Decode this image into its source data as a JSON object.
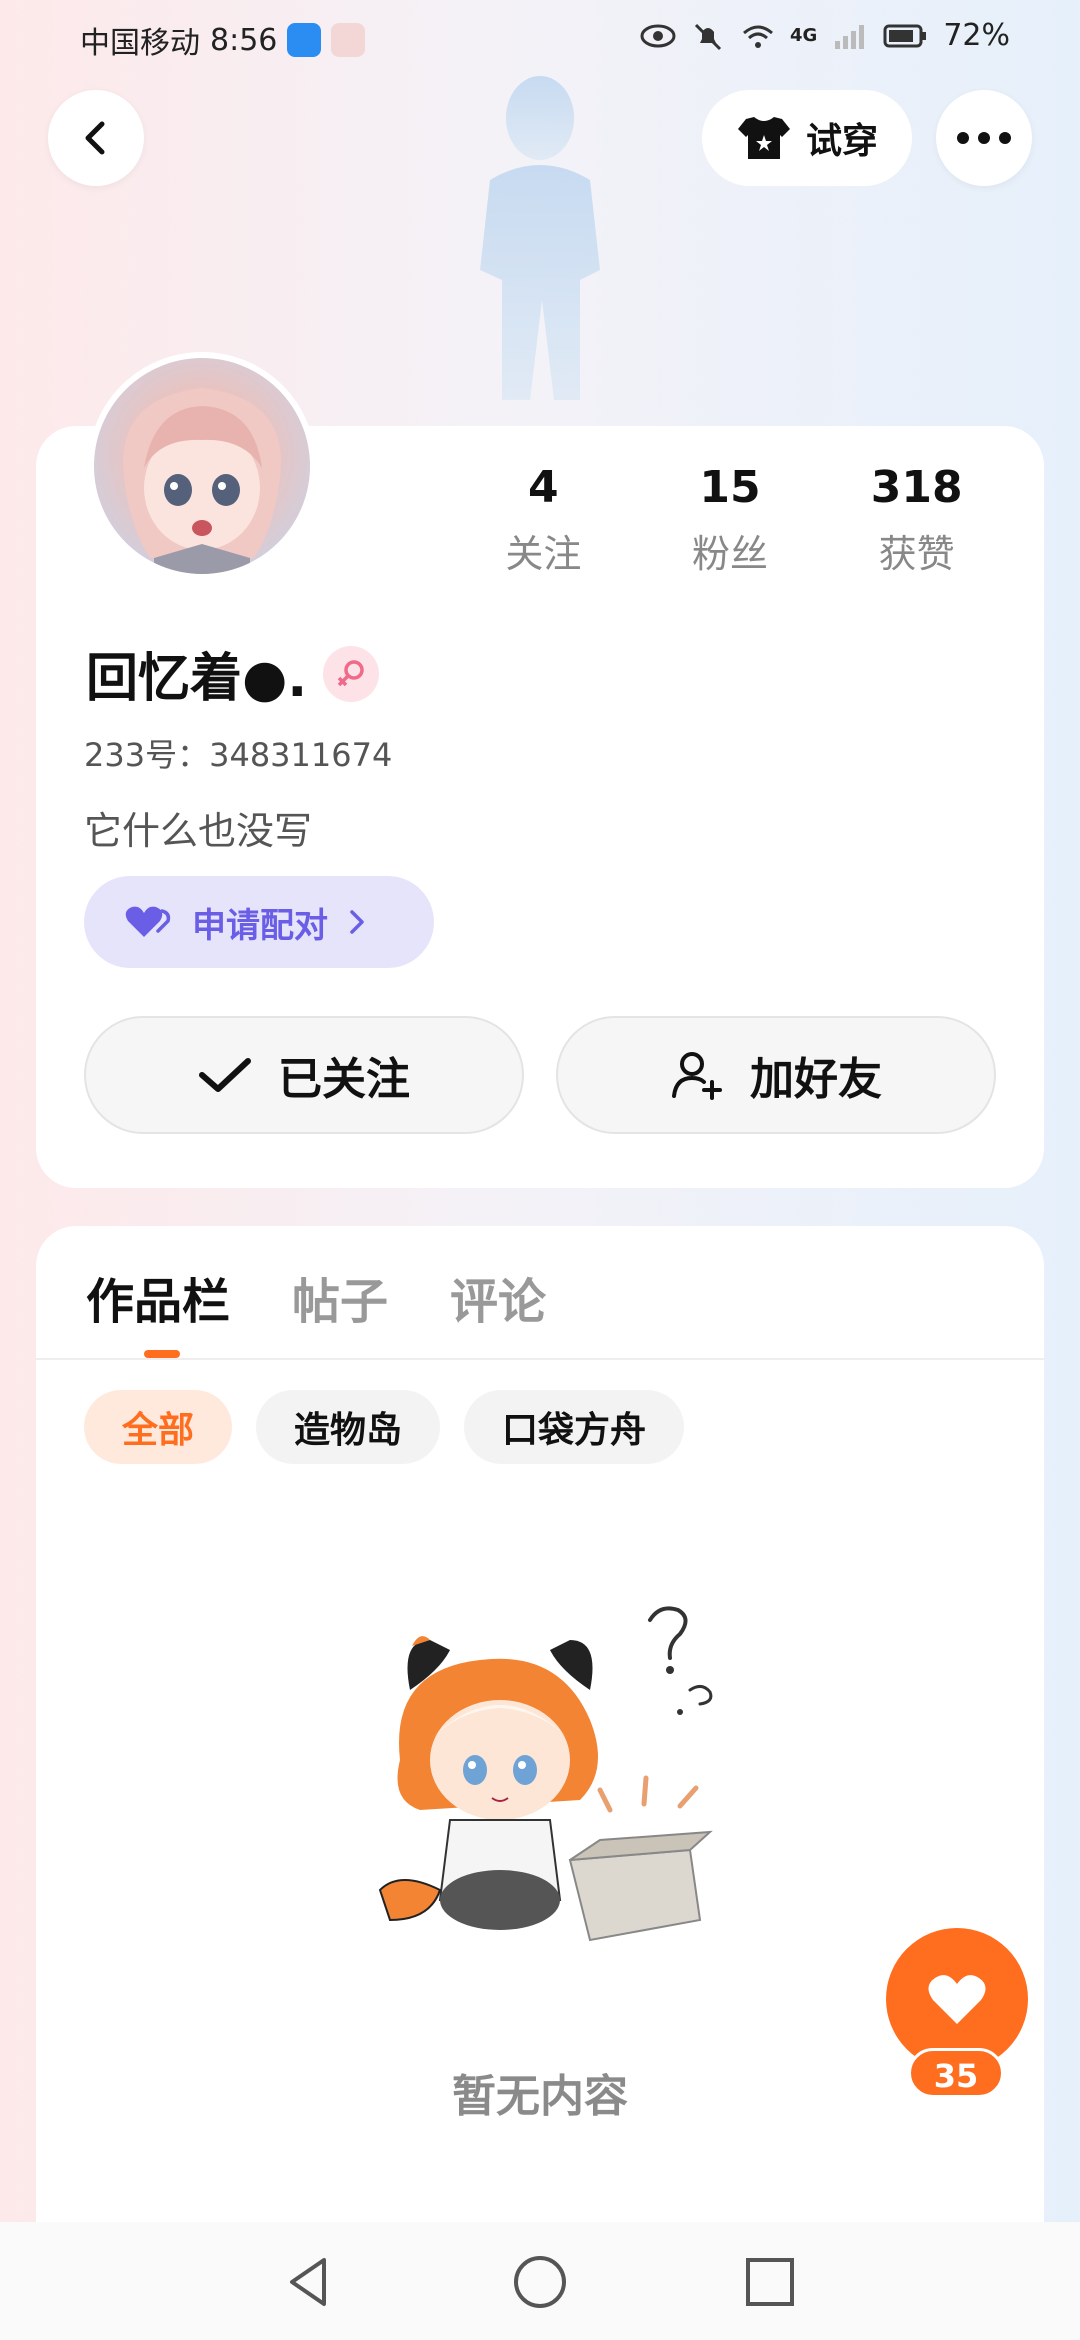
{
  "status_bar": {
    "carrier": "中国移动",
    "time": "8:56",
    "network": "4G",
    "battery": "72%"
  },
  "header": {
    "back_icon": "chevron-left-icon",
    "try_on_label": "试穿",
    "more_icon": "ellipsis-icon"
  },
  "profile": {
    "stats": [
      {
        "value": "4",
        "label": "关注"
      },
      {
        "value": "15",
        "label": "粉丝"
      },
      {
        "value": "318",
        "label": "获赞"
      }
    ],
    "name": "回忆着●.",
    "gender_icon": "female-icon",
    "uid_label": "233号：",
    "uid": "348311674",
    "bio": "它什么也没写",
    "pair_label": "申请配对",
    "follow_label": "已关注",
    "add_friend_label": "加好友"
  },
  "works": {
    "tabs": [
      "作品栏",
      "帖子",
      "评论"
    ],
    "filters": [
      "全部",
      "造物岛",
      "口袋方舟"
    ],
    "empty_text": "暂无内容"
  },
  "like_fab": {
    "count": "35"
  },
  "colors": {
    "accent": "#ff6d1f",
    "pair_bg": "#e6e4fb",
    "pair_text": "#6a5ee6"
  }
}
